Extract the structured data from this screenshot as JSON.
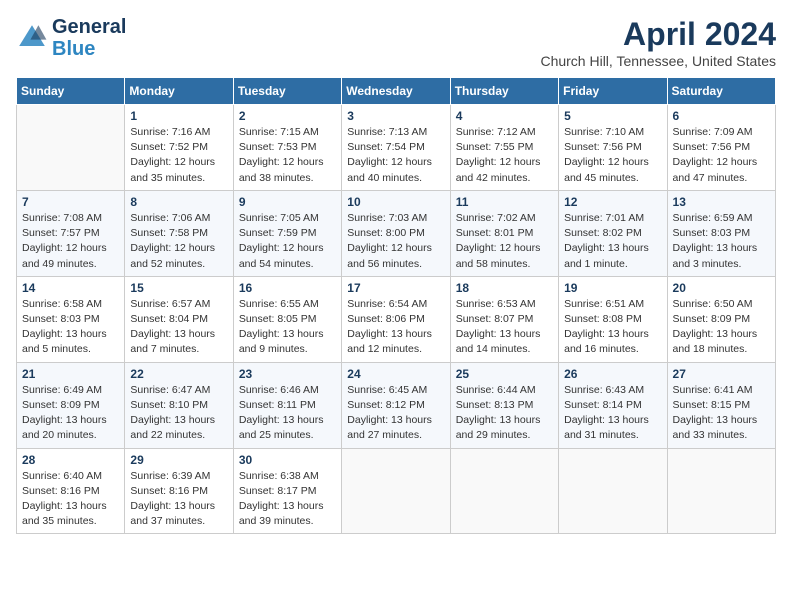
{
  "logo": {
    "line1": "General",
    "line2": "Blue"
  },
  "title": "April 2024",
  "location": "Church Hill, Tennessee, United States",
  "days_header": [
    "Sunday",
    "Monday",
    "Tuesday",
    "Wednesday",
    "Thursday",
    "Friday",
    "Saturday"
  ],
  "weeks": [
    [
      {
        "num": "",
        "info": ""
      },
      {
        "num": "1",
        "info": "Sunrise: 7:16 AM\nSunset: 7:52 PM\nDaylight: 12 hours\nand 35 minutes."
      },
      {
        "num": "2",
        "info": "Sunrise: 7:15 AM\nSunset: 7:53 PM\nDaylight: 12 hours\nand 38 minutes."
      },
      {
        "num": "3",
        "info": "Sunrise: 7:13 AM\nSunset: 7:54 PM\nDaylight: 12 hours\nand 40 minutes."
      },
      {
        "num": "4",
        "info": "Sunrise: 7:12 AM\nSunset: 7:55 PM\nDaylight: 12 hours\nand 42 minutes."
      },
      {
        "num": "5",
        "info": "Sunrise: 7:10 AM\nSunset: 7:56 PM\nDaylight: 12 hours\nand 45 minutes."
      },
      {
        "num": "6",
        "info": "Sunrise: 7:09 AM\nSunset: 7:56 PM\nDaylight: 12 hours\nand 47 minutes."
      }
    ],
    [
      {
        "num": "7",
        "info": "Sunrise: 7:08 AM\nSunset: 7:57 PM\nDaylight: 12 hours\nand 49 minutes."
      },
      {
        "num": "8",
        "info": "Sunrise: 7:06 AM\nSunset: 7:58 PM\nDaylight: 12 hours\nand 52 minutes."
      },
      {
        "num": "9",
        "info": "Sunrise: 7:05 AM\nSunset: 7:59 PM\nDaylight: 12 hours\nand 54 minutes."
      },
      {
        "num": "10",
        "info": "Sunrise: 7:03 AM\nSunset: 8:00 PM\nDaylight: 12 hours\nand 56 minutes."
      },
      {
        "num": "11",
        "info": "Sunrise: 7:02 AM\nSunset: 8:01 PM\nDaylight: 12 hours\nand 58 minutes."
      },
      {
        "num": "12",
        "info": "Sunrise: 7:01 AM\nSunset: 8:02 PM\nDaylight: 13 hours\nand 1 minute."
      },
      {
        "num": "13",
        "info": "Sunrise: 6:59 AM\nSunset: 8:03 PM\nDaylight: 13 hours\nand 3 minutes."
      }
    ],
    [
      {
        "num": "14",
        "info": "Sunrise: 6:58 AM\nSunset: 8:03 PM\nDaylight: 13 hours\nand 5 minutes."
      },
      {
        "num": "15",
        "info": "Sunrise: 6:57 AM\nSunset: 8:04 PM\nDaylight: 13 hours\nand 7 minutes."
      },
      {
        "num": "16",
        "info": "Sunrise: 6:55 AM\nSunset: 8:05 PM\nDaylight: 13 hours\nand 9 minutes."
      },
      {
        "num": "17",
        "info": "Sunrise: 6:54 AM\nSunset: 8:06 PM\nDaylight: 13 hours\nand 12 minutes."
      },
      {
        "num": "18",
        "info": "Sunrise: 6:53 AM\nSunset: 8:07 PM\nDaylight: 13 hours\nand 14 minutes."
      },
      {
        "num": "19",
        "info": "Sunrise: 6:51 AM\nSunset: 8:08 PM\nDaylight: 13 hours\nand 16 minutes."
      },
      {
        "num": "20",
        "info": "Sunrise: 6:50 AM\nSunset: 8:09 PM\nDaylight: 13 hours\nand 18 minutes."
      }
    ],
    [
      {
        "num": "21",
        "info": "Sunrise: 6:49 AM\nSunset: 8:09 PM\nDaylight: 13 hours\nand 20 minutes."
      },
      {
        "num": "22",
        "info": "Sunrise: 6:47 AM\nSunset: 8:10 PM\nDaylight: 13 hours\nand 22 minutes."
      },
      {
        "num": "23",
        "info": "Sunrise: 6:46 AM\nSunset: 8:11 PM\nDaylight: 13 hours\nand 25 minutes."
      },
      {
        "num": "24",
        "info": "Sunrise: 6:45 AM\nSunset: 8:12 PM\nDaylight: 13 hours\nand 27 minutes."
      },
      {
        "num": "25",
        "info": "Sunrise: 6:44 AM\nSunset: 8:13 PM\nDaylight: 13 hours\nand 29 minutes."
      },
      {
        "num": "26",
        "info": "Sunrise: 6:43 AM\nSunset: 8:14 PM\nDaylight: 13 hours\nand 31 minutes."
      },
      {
        "num": "27",
        "info": "Sunrise: 6:41 AM\nSunset: 8:15 PM\nDaylight: 13 hours\nand 33 minutes."
      }
    ],
    [
      {
        "num": "28",
        "info": "Sunrise: 6:40 AM\nSunset: 8:16 PM\nDaylight: 13 hours\nand 35 minutes."
      },
      {
        "num": "29",
        "info": "Sunrise: 6:39 AM\nSunset: 8:16 PM\nDaylight: 13 hours\nand 37 minutes."
      },
      {
        "num": "30",
        "info": "Sunrise: 6:38 AM\nSunset: 8:17 PM\nDaylight: 13 hours\nand 39 minutes."
      },
      {
        "num": "",
        "info": ""
      },
      {
        "num": "",
        "info": ""
      },
      {
        "num": "",
        "info": ""
      },
      {
        "num": "",
        "info": ""
      }
    ]
  ]
}
